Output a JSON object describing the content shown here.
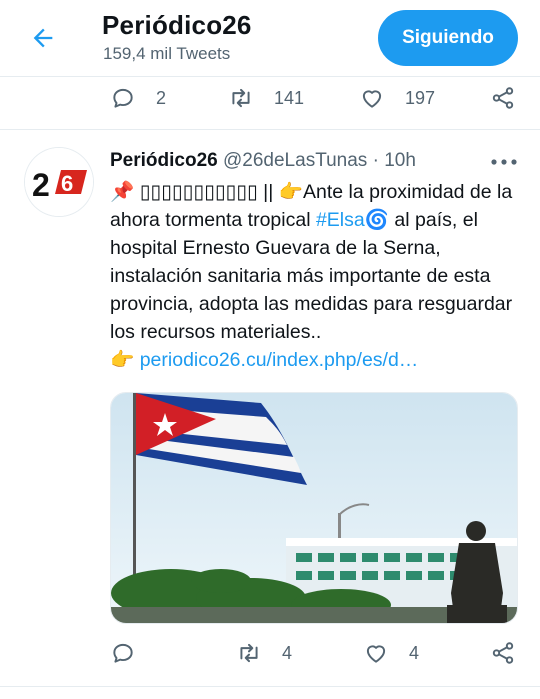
{
  "header": {
    "title": "Periódico26",
    "subtitle": "159,4 mil Tweets",
    "follow_label": "Siguiendo"
  },
  "prev_tweet": {
    "replies": "2",
    "retweets": "141",
    "likes": "197"
  },
  "tweet": {
    "author_name": "Periódico26",
    "author_handle": "@26deLasTunas",
    "separator": " · ",
    "time": "10h",
    "avatar_text": "26",
    "pin_emoji": "📌",
    "garbled": "▯▯▯▯▯▯▯▯▯▯▯",
    "pipes": " || ",
    "point_emoji": "👉",
    "text_1": "Ante la proximidad de la ahora tormenta tropical ",
    "hashtag": "#Elsa",
    "cyclone_emoji": "🌀",
    "text_2": " al país, el hospital Ernesto Guevara de la Serna, instalación sanitaria más importante de esta provincia, adopta las medidas para resguardar los recursos materiales..",
    "link_emoji": "👉",
    "link": "periodico26.cu/index.php/es/d…",
    "replies": "",
    "retweets": "4",
    "likes": "4"
  },
  "colors": {
    "accent": "#1d9bf0",
    "muted": "#536471",
    "text": "#0f1419",
    "divider": "#e6ecf0"
  },
  "icons": [
    "back-arrow-icon",
    "reply-icon",
    "retweet-icon",
    "like-icon",
    "share-icon",
    "more-icon"
  ]
}
